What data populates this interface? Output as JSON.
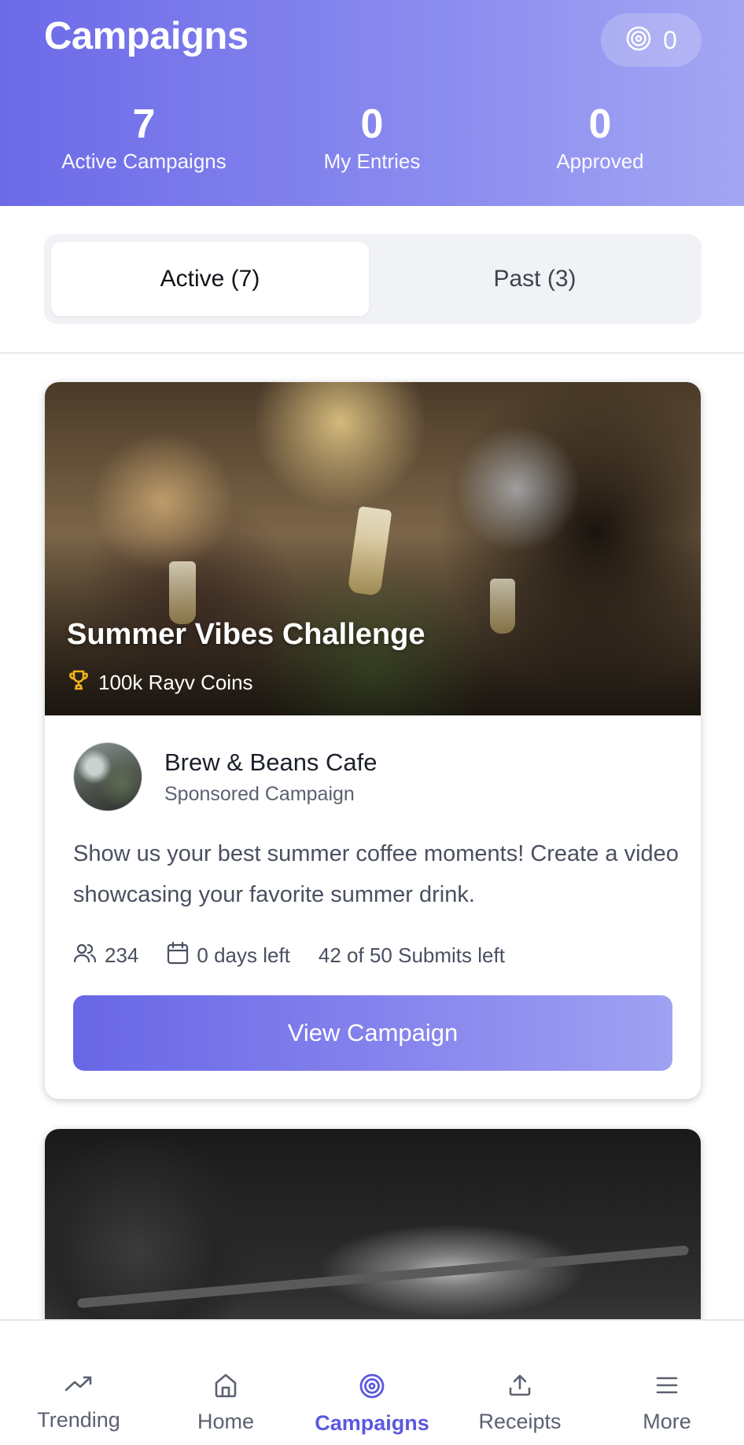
{
  "header": {
    "title": "Campaigns",
    "target_count": "0",
    "stats": [
      {
        "value": "7",
        "label": "Active Campaigns"
      },
      {
        "value": "0",
        "label": "My Entries"
      },
      {
        "value": "0",
        "label": "Approved"
      }
    ]
  },
  "tabs": [
    {
      "label": "Active (7)",
      "selected": true
    },
    {
      "label": "Past (3)",
      "selected": false
    }
  ],
  "campaigns": [
    {
      "title": "Summer Vibes Challenge",
      "reward": "100k Rayv Coins",
      "sponsor_name": "Brew & Beans Cafe",
      "sponsor_type": "Sponsored Campaign",
      "description": "Show us your best summer coffee moments! Create a video showcasing your favorite summer drink.",
      "participants": "234",
      "days_left": "0 days left",
      "submits_left": "42 of 50 Submits left",
      "cta_label": "View Campaign"
    }
  ],
  "nav": [
    {
      "label": "Trending",
      "icon": "trending-icon",
      "active": false
    },
    {
      "label": "Home",
      "icon": "home-icon",
      "active": false
    },
    {
      "label": "Campaigns",
      "icon": "target-icon",
      "active": true
    },
    {
      "label": "Receipts",
      "icon": "upload-icon",
      "active": false
    },
    {
      "label": "More",
      "icon": "menu-icon",
      "active": false
    }
  ],
  "colors": {
    "accent": "#5b58e0",
    "header_start": "#6c6ae8",
    "header_end": "#a3a6f3",
    "trophy": "#f2b51b"
  }
}
